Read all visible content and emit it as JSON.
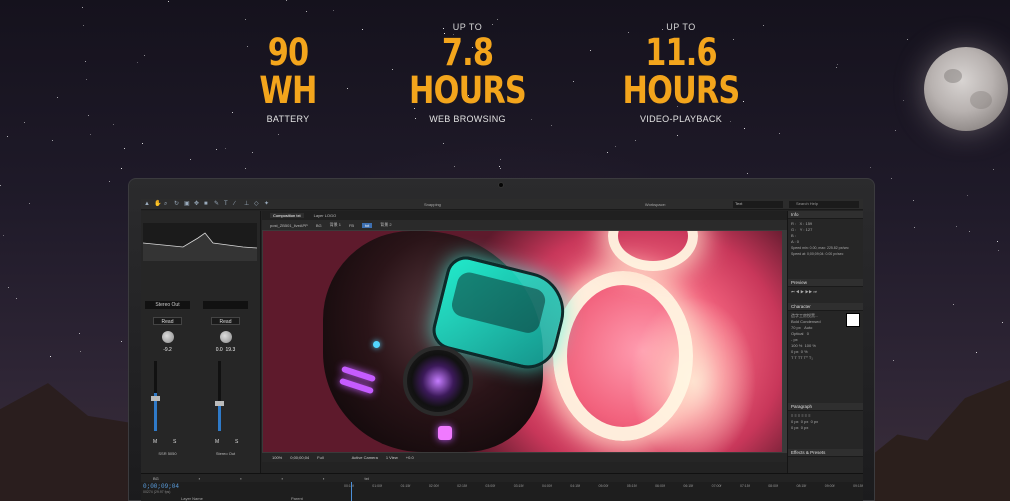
{
  "stats": [
    {
      "pre": "",
      "big": "90 WH",
      "post": "BATTERY"
    },
    {
      "pre": "UP TO",
      "big": "7.8 HOURS",
      "post": "WEB BROWSING"
    },
    {
      "pre": "UP TO",
      "big": "11.6 HOURS",
      "post": "VIDEO-PLAYBACK"
    }
  ],
  "app": {
    "toolbar": {
      "snapping": "Snapping",
      "workspace_label": "Workspace:",
      "workspace_value": "Text",
      "search_placeholder": "Search Help"
    },
    "comp_tabs": [
      "Composition",
      "Layer LOGO"
    ],
    "comp_tab_suffix": "txt",
    "breadcrumbs": [
      "post_ZB501_liveAPP",
      "BG",
      "背景 1",
      "FB",
      "txt",
      "背景 2"
    ],
    "audio": {
      "channels": [
        {
          "name": "Stereo Out",
          "mode": "Read",
          "value": "-9.2",
          "sub": "SSR 5050"
        },
        {
          "name": "",
          "mode": "Read",
          "value": "0.0",
          "value2": "19.3",
          "sub": "Stereo Out"
        }
      ],
      "ms": [
        "M",
        "S"
      ],
      "fill_levels": [
        0.55,
        0.4
      ]
    },
    "viewer_bar": {
      "zoom": "100%",
      "timecode": "0;00;00;04",
      "resolution": "Full",
      "camera": "Active Camera",
      "view": "1 View",
      "offset": "+0.0"
    },
    "panels": {
      "info": {
        "title": "Info",
        "x": "X : 159",
        "y": "Y : 127",
        "r": "R :",
        "g": "G :",
        "b": "B :",
        "a": "A : 0",
        "speed1": "Speed min: 0.00, max: 225.82 px/sec",
        "speed2": "Speed at: 0;00;09;04: 0.00 px/sec"
      },
      "preview": {
        "title": "Preview"
      },
      "character": {
        "title": "Character",
        "font": "造字工房悦黑...",
        "style": "Bold Condensed",
        "size": "70 px",
        "leading": "Auto",
        "tracking": "Optical",
        "kerning": "0",
        "unit": "- px",
        "vscale": "100 %",
        "hscale": "100 %",
        "baseline": "0 px",
        "tsume": "0 %"
      },
      "paragraph": {
        "title": "Paragraph",
        "v1": "0 px",
        "v2": "0 px",
        "v3": "0 px",
        "v4": "0 px",
        "v5": "0 px"
      },
      "effects": {
        "title": "Effects & Presets"
      }
    },
    "timeline": {
      "tabs": [
        "BG",
        "",
        "",
        "",
        "",
        "",
        "",
        "",
        "",
        "txt"
      ],
      "current_time": "0;00;09;04",
      "fps": "00274 (29.97 fps)",
      "layer_name_header": "Layer Name",
      "parent_header": "Parent",
      "ruler": [
        "00:15f",
        "01:00f",
        "01:15f",
        "02:00f",
        "02:15f",
        "03:00f",
        "03:15f",
        "04:00f",
        "04:15f",
        "05:00f",
        "05:15f",
        "06:00f",
        "06:15f",
        "07:00f",
        "07:15f",
        "08:00f",
        "08:15f",
        "09:00f",
        "09:15f"
      ]
    }
  },
  "colors": {
    "accent": "#f3a51c",
    "ui_blue": "#3d6fb0"
  }
}
